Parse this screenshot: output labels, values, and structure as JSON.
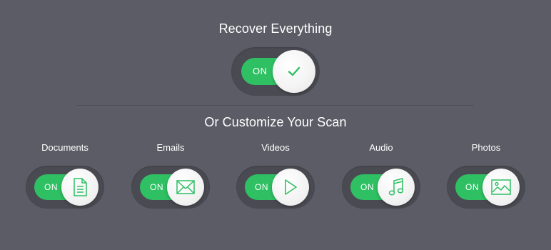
{
  "header": {
    "title": "Recover Everything"
  },
  "main_toggle": {
    "state_label": "ON",
    "icon": "check-icon",
    "on": true
  },
  "section": {
    "subtitle": "Or Customize Your Scan"
  },
  "categories": [
    {
      "label": "Documents",
      "state_label": "ON",
      "icon": "document-icon",
      "on": true
    },
    {
      "label": "Emails",
      "state_label": "ON",
      "icon": "envelope-icon",
      "on": true
    },
    {
      "label": "Videos",
      "state_label": "ON",
      "icon": "play-icon",
      "on": true
    },
    {
      "label": "Audio",
      "state_label": "ON",
      "icon": "music-note-icon",
      "on": true
    },
    {
      "label": "Photos",
      "state_label": "ON",
      "icon": "image-icon",
      "on": true
    }
  ],
  "colors": {
    "background": "#5c5c66",
    "track": "#4a4a52",
    "accent_green": "#2fc063",
    "icon_green": "#2fc063",
    "text": "#ffffff"
  }
}
